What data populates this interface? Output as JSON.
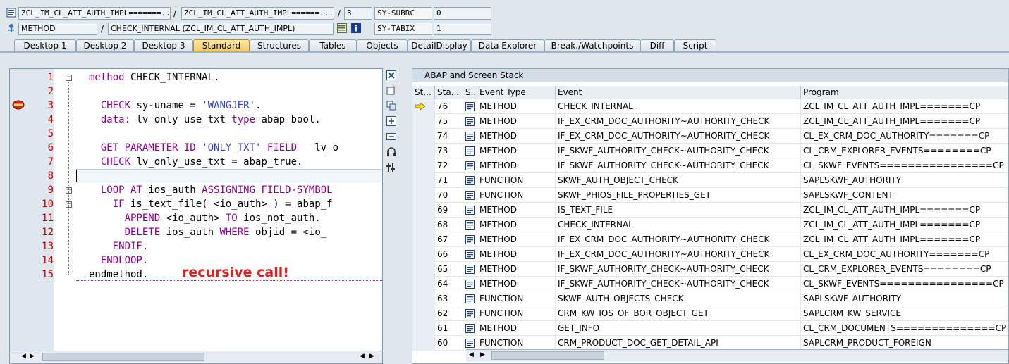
{
  "header": {
    "program_field": "ZCL_IM_CL_ATT_AUTH_IMPL=======...",
    "include_field": "ZCL_IM_CL_ATT_AUTH_IMPL======...",
    "separator": "/",
    "line_field": "3",
    "sysubrc_label": "SY-SUBRC",
    "sysubrc_value": "0",
    "event_type_field": "METHOD",
    "event_field": "CHECK_INTERNAL (ZCL_IM_CL_ATT_AUTH_IMPL)",
    "sytabix_label": "SY-TABIX",
    "sytabix_value": "1"
  },
  "tabs": [
    {
      "label": "Desktop 1"
    },
    {
      "label": "Desktop 2"
    },
    {
      "label": "Desktop 3"
    },
    {
      "label": "Standard"
    },
    {
      "label": "Structures"
    },
    {
      "label": "Tables"
    },
    {
      "label": "Objects"
    },
    {
      "label": "DetailDisplay"
    },
    {
      "label": "Data Explorer"
    },
    {
      "label": "Break./Watchpoints"
    },
    {
      "label": "Diff"
    },
    {
      "label": "Script"
    }
  ],
  "active_tab": "Standard",
  "editor": {
    "line_numbers": [
      "1",
      "2",
      "3",
      "4",
      "5",
      "6",
      "7",
      "8",
      "9",
      "10",
      "11",
      "12",
      "13",
      "14",
      "15"
    ],
    "annotation": "recursive call!"
  },
  "stack": {
    "title": "ABAP and Screen Stack",
    "columns": [
      "St...",
      "Sta...",
      "S...",
      "Event Type",
      "Event",
      "Program"
    ],
    "rows": [
      {
        "level": "76",
        "type": "METHOD",
        "event": "CHECK_INTERNAL",
        "program": "ZCL_IM_CL_ATT_AUTH_IMPL=======CP",
        "current": true
      },
      {
        "level": "75",
        "type": "METHOD",
        "event": "IF_EX_CRM_DOC_AUTHORITY~AUTHORITY_CHECK",
        "program": "ZCL_IM_CL_ATT_AUTH_IMPL=======CP"
      },
      {
        "level": "74",
        "type": "METHOD",
        "event": "IF_EX_CRM_DOC_AUTHORITY~AUTHORITY_CHECK",
        "program": "CL_EX_CRM_DOC_AUTHORITY=======CP"
      },
      {
        "level": "73",
        "type": "METHOD",
        "event": "IF_SKWF_AUTHORITY_CHECK~AUTHORITY_CHECK",
        "program": "CL_CRM_EXPLORER_EVENTS========CP"
      },
      {
        "level": "72",
        "type": "METHOD",
        "event": "IF_SKWF_AUTHORITY_CHECK~AUTHORITY_CHECK",
        "program": "CL_SKWF_EVENTS================CP"
      },
      {
        "level": "71",
        "type": "FUNCTION",
        "event": "SKWF_AUTH_OBJECT_CHECK",
        "program": "SAPLSKWF_AUTHORITY"
      },
      {
        "level": "70",
        "type": "FUNCTION",
        "event": "SKWF_PHIOS_FILE_PROPERTIES_GET",
        "program": "SAPLSKWF_CONTENT"
      },
      {
        "level": "69",
        "type": "METHOD",
        "event": "IS_TEXT_FILE",
        "program": "ZCL_IM_CL_ATT_AUTH_IMPL=======CP"
      },
      {
        "level": "68",
        "type": "METHOD",
        "event": "CHECK_INTERNAL",
        "program": "ZCL_IM_CL_ATT_AUTH_IMPL=======CP"
      },
      {
        "level": "67",
        "type": "METHOD",
        "event": "IF_EX_CRM_DOC_AUTHORITY~AUTHORITY_CHECK",
        "program": "ZCL_IM_CL_ATT_AUTH_IMPL=======CP"
      },
      {
        "level": "66",
        "type": "METHOD",
        "event": "IF_EX_CRM_DOC_AUTHORITY~AUTHORITY_CHECK",
        "program": "CL_EX_CRM_DOC_AUTHORITY=======CP"
      },
      {
        "level": "65",
        "type": "METHOD",
        "event": "IF_SKWF_AUTHORITY_CHECK~AUTHORITY_CHECK",
        "program": "CL_CRM_EXPLORER_EVENTS========CP"
      },
      {
        "level": "64",
        "type": "METHOD",
        "event": "IF_SKWF_AUTHORITY_CHECK~AUTHORITY_CHECK",
        "program": "CL_SKWF_EVENTS================CP"
      },
      {
        "level": "63",
        "type": "FUNCTION",
        "event": "SKWF_AUTH_OBJECTS_CHECK",
        "program": "SAPLSKWF_AUTHORITY"
      },
      {
        "level": "62",
        "type": "FUNCTION",
        "event": "CRM_KW_IOS_OF_BOR_OBJECT_GET",
        "program": "SAPLCRM_KW_SERVICE"
      },
      {
        "level": "61",
        "type": "METHOD",
        "event": "GET_INFO",
        "program": "CL_CRM_DOCUMENTS==============CP"
      },
      {
        "level": "60",
        "type": "FUNCTION",
        "event": "CRM_PRODUCT_DOC_GET_DETAIL_API",
        "program": "SAPLCRM_PRODUCT_FOREIGN"
      }
    ]
  },
  "colors": {
    "keyword": "#8b008b",
    "string": "#3040c0",
    "line_number": "#c00000",
    "annotation": "#e02020",
    "active_tab": "#f1c75b"
  }
}
